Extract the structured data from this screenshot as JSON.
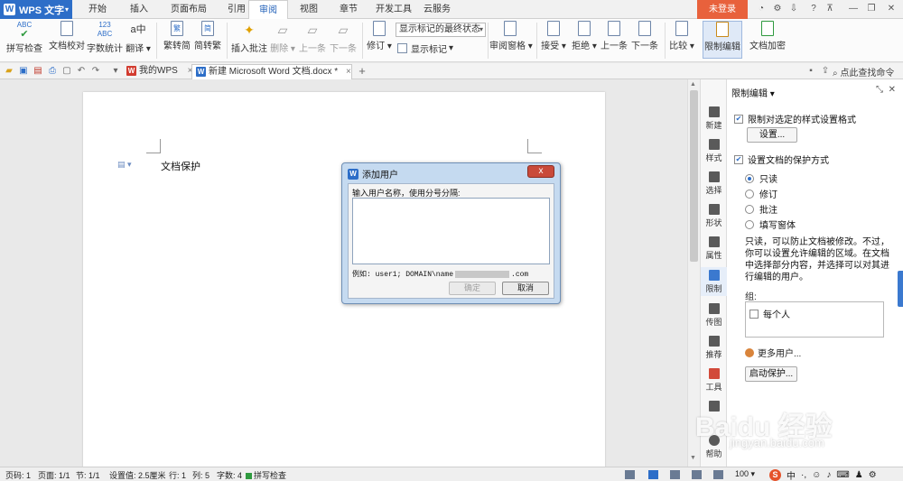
{
  "app": {
    "name": "WPS 文字"
  },
  "menu": {
    "tabs": [
      "开始",
      "插入",
      "页面布局",
      "引用",
      "审阅",
      "视图",
      "章节",
      "开发工具",
      "云服务"
    ],
    "active": "审阅",
    "login_label": "未登录"
  },
  "ribbon": {
    "spell_check": "拼写检查",
    "doc_proof": "文档校对",
    "word_count": "字数统计",
    "translate": "翻译",
    "trad_to_simp": "繁转简",
    "simp_to_trad": "简转繁",
    "insert_comment": "插入批注",
    "delete": "删除",
    "prev": "上一条",
    "next": "下一条",
    "revise": "修订",
    "markup_mode": "显示标记的最终状态",
    "show_markup": "显示标记",
    "review_pane": "审阅窗格",
    "accept": "接受",
    "reject": "拒绝",
    "prev2": "上一条",
    "next2": "下一条",
    "compare": "比较",
    "restrict_edit": "限制编辑",
    "doc_encrypt": "文档加密",
    "icon_text_abc": "ABC",
    "icon_text_123": "123",
    "icon_text_a": "a",
    "icon_text_zhong": "中",
    "icon_text_fan": "繁",
    "icon_text_jian": "简"
  },
  "tabs": {
    "my_wps": "我的WPS",
    "doc": "新建 Microsoft Word 文档.docx *",
    "new_tab": "+",
    "search_cmd": "点此查找命令"
  },
  "document": {
    "text": "文档保护"
  },
  "dialog": {
    "title": "添加用户",
    "close": "x",
    "prompt": "输入用户名称，使用分号分隔:",
    "example_prefix": "例如: user1; DOMAIN\\name",
    "example_suffix": ".com",
    "ok": "确定",
    "cancel": "取消"
  },
  "sidebar": {
    "items": [
      "新建",
      "样式",
      "选择",
      "形状",
      "属性",
      "限制",
      "传图",
      "推荐",
      "工具",
      "",
      "帮助"
    ],
    "active_index": 5
  },
  "panel": {
    "title": "限制编辑",
    "title_caret": "▾",
    "format_limit": "限制对选定的样式设置格式",
    "settings_btn": "设置...",
    "protect_mode": "设置文档的保护方式",
    "options": [
      "只读",
      "修订",
      "批注",
      "填写窗体"
    ],
    "selected_option": 0,
    "description": "只读，可以防止文档被修改。不过，你可以设置允许编辑的区域。在文档中选择部分内容，并选择可以对其进行编辑的用户。",
    "group_label": "组:",
    "everyone": "每个人",
    "more_users": "更多用户...",
    "start_protect": "启动保护..."
  },
  "status": {
    "page_code": "页码: 1",
    "page": "页面: 1/1",
    "section": "节: 1/1",
    "setting": "设置值: 2.5厘米",
    "row": "行: 1",
    "col": "列: 5",
    "chars": "字数: 4",
    "spell": "拼写检查",
    "zoom": "100",
    "ime_zh": "中"
  },
  "watermark": {
    "brand": "Baidu 经验",
    "url": "jingyan.baidu.com"
  },
  "colors": {
    "accent": "#2d6ec8",
    "login": "#e8613c",
    "close": "#c94a3a"
  }
}
